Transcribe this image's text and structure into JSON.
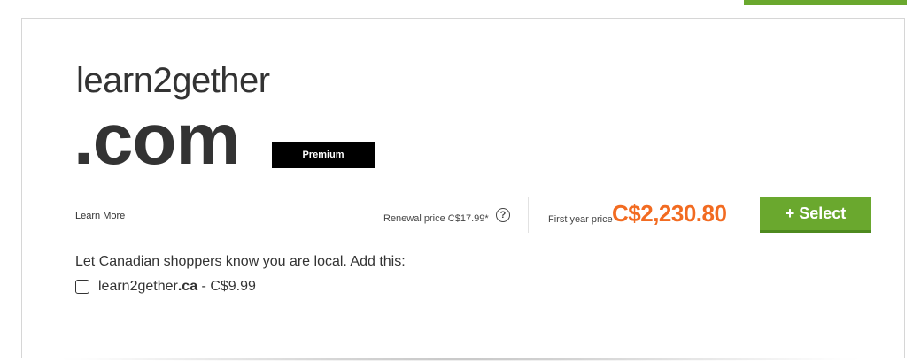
{
  "domain": {
    "name": "learn2gether",
    "tld": ".com",
    "badge": "Premium"
  },
  "links": {
    "learn_more": "Learn More"
  },
  "pricing": {
    "renewal_label": "Renewal price",
    "renewal_value": "C$17.99*",
    "help_icon": "?",
    "first_year_label": "First year price",
    "first_year_value": "C$2,230.80",
    "select_label": "+ Select"
  },
  "addon": {
    "message": "Let Canadian shoppers know you are local. Add this:",
    "domain_name": "learn2gether",
    "domain_tld": ".ca",
    "price_text": " - C$9.99",
    "checked": false
  },
  "colors": {
    "accent_green": "#6aa82e",
    "price_orange": "#f26b21",
    "badge_black": "#000000"
  }
}
